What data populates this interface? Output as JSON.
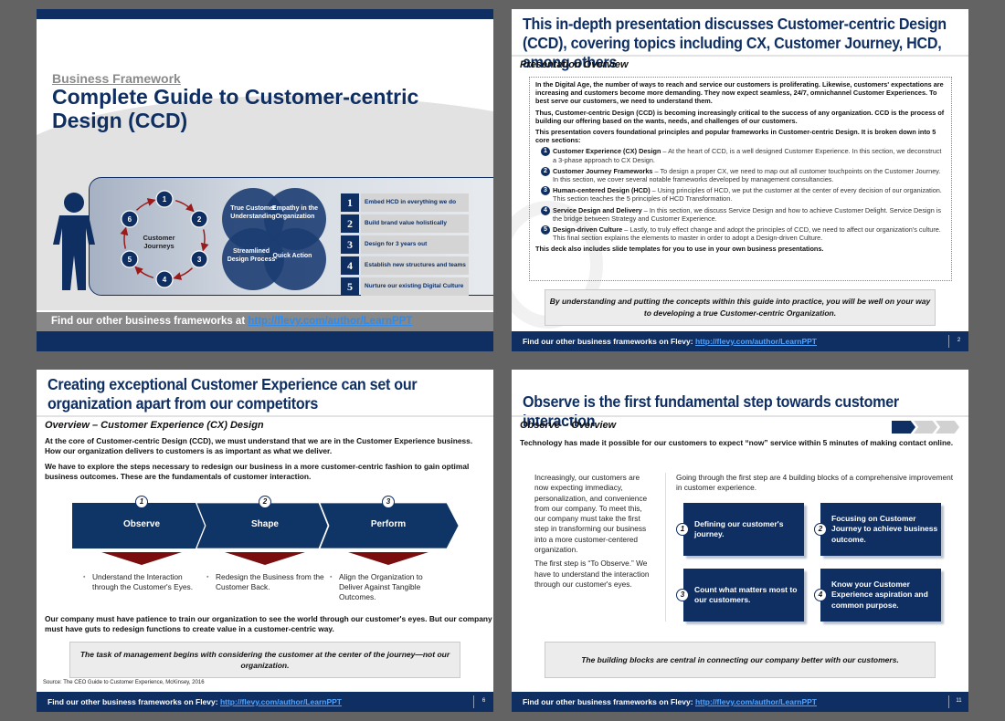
{
  "footer": {
    "prefix": "Find our other business frameworks on Flevy:",
    "link": "http://flevy.com/author/LearnPPT"
  },
  "slide1": {
    "kicker": "Business Framework",
    "title": "Complete Guide to Customer-centric Design (CCD)",
    "cycle_label": "Customer Journeys",
    "cycle_steps": [
      "1",
      "2",
      "3",
      "4",
      "5",
      "6"
    ],
    "venn": [
      "True Customer Understanding",
      "Empathy in the Organization",
      "Streamlined Design Process",
      "Quick Action"
    ],
    "list": [
      {
        "num": "1",
        "text": "Embed HCD in everything we do"
      },
      {
        "num": "2",
        "text": "Build brand value holistically"
      },
      {
        "num": "3",
        "text": "Design for 3 years out"
      },
      {
        "num": "4",
        "text": "Establish new structures and teams"
      },
      {
        "num": "5",
        "text": "Nurture our existing Digital Culture"
      }
    ],
    "banner_prefix": "Find our other business frameworks at",
    "banner_link": "http://flevy.com/author/LearnPPT"
  },
  "slide2": {
    "title": "This in-depth presentation discusses Customer-centric Design (CCD), covering topics including CX, Customer Journey, HCD, among others",
    "subtitle": "Presentation Overview",
    "para1": "In the Digital Age, the number of ways to reach and service our customers is proliferating. Likewise, customers' expectations are increasing and customers become more demanding.  They now expect seamless, 24/7, omnichannel Customer Experiences.  To best serve our customers, we need to understand them.",
    "para2": "Thus, Customer-centric Design (CCD) is becoming increasingly critical to the success of any organization.  CCD is the process of building our offering based on the wants, needs, and challenges of our customers.",
    "para3": "This presentation covers foundational principles and popular frameworks in Customer-centric Design.  It is broken down into 5 core sections:",
    "sections": [
      {
        "num": "1",
        "name": "Customer Experience (CX) Design",
        "desc": " – At the heart of CCD, is a well designed Customer Experience.  In this section, we deconstruct a 3-phase approach to CX Design."
      },
      {
        "num": "2",
        "name": "Customer Journey Frameworks",
        "desc": " – To design a proper CX, we need to map out all customer touchpoints on the Customer Journey.  In this section, we cover several notable frameworks developed by management consultancies."
      },
      {
        "num": "3",
        "name": "Human-centered Design (HCD)",
        "desc": " – Using principles of HCD, we put the customer at the center of every decision of our organization.  This section teaches the 5 principles of HCD Transformation."
      },
      {
        "num": "4",
        "name": "Service Design and Delivery",
        "desc": " – In this section, we discuss Service Design and how to achieve Customer Delight.  Service Design is the bridge between Strategy and Customer Experience."
      },
      {
        "num": "5",
        "name": "Design-driven Culture",
        "desc": " – Lastly, to truly effect change and adopt the principles of CCD, we need to affect our organization's culture.  This final section explains the elements to master in order to adopt a Design-driven Culture."
      }
    ],
    "closing": "This deck also includes slide templates for you to use in your own business presentations.",
    "quote": "By understanding and putting the concepts within this guide into practice, you will be well on your way to developing a true Customer-centric Organization.",
    "page": "2"
  },
  "slide3": {
    "title": "Creating exceptional Customer Experience can set our organization apart from our competitors",
    "subtitle": "Overview – Customer Experience (CX) Design",
    "para1": "At the core of Customer-centric Design (CCD), we must understand that we are in the Customer Experience business.  How our organization delivers to customers is as important as what we deliver.",
    "para2": "We have to explore the steps necessary to redesign our business in a more customer-centric fashion to gain optimal business outcomes.  These are the fundamentals of customer interaction.",
    "phases": [
      {
        "num": "1",
        "label": "Observe",
        "bullet": "Understand the Interaction through the Customer's Eyes."
      },
      {
        "num": "2",
        "label": "Shape",
        "bullet": "Redesign the Business from the Customer Back."
      },
      {
        "num": "3",
        "label": "Perform",
        "bullet": "Align the Organization to Deliver Against Tangible Outcomes."
      }
    ],
    "para3": "Our company must have patience to train our organization to see the world through our customer's eyes. But our company must have guts to redesign functions to create value in a customer-centric way.",
    "quote": "The task of management begins with considering the customer at the center of the journey—not our organization.",
    "source": "Source: The CEO Guide to Customer Experience, McKinsey, 2016",
    "page": "6"
  },
  "slide4": {
    "title": "Observe is the first fundamental step towards customer interaction",
    "subtitle": "Observe – Overview",
    "progress": {
      "current_step": 1,
      "total_steps": 3
    },
    "lead": "Technology has made it possible for our customers to expect “now” service within 5 minutes of making contact online.",
    "left_p1": "Increasingly, our customers are now expecting immediacy, personalization, and convenience from our company.   To meet this, our company must take the first step in transforming our business into a more customer-centered organization.",
    "left_p2": "The first step is “To Observe.” We have to understand the interaction through our customer's eyes.",
    "right_lead": "Going through the first step are 4 building blocks of a comprehensive improvement in customer experience.",
    "blocks": [
      {
        "num": "1",
        "text": "Defining our customer's journey."
      },
      {
        "num": "2",
        "text": "Focusing on Customer Journey to achieve business outcome."
      },
      {
        "num": "3",
        "text": "Count what matters most to our customers."
      },
      {
        "num": "4",
        "text": "Know your Customer Experience aspiration and common purpose."
      }
    ],
    "quote": "The building blocks are central in connecting our company better with our customers.",
    "page": "11"
  }
}
